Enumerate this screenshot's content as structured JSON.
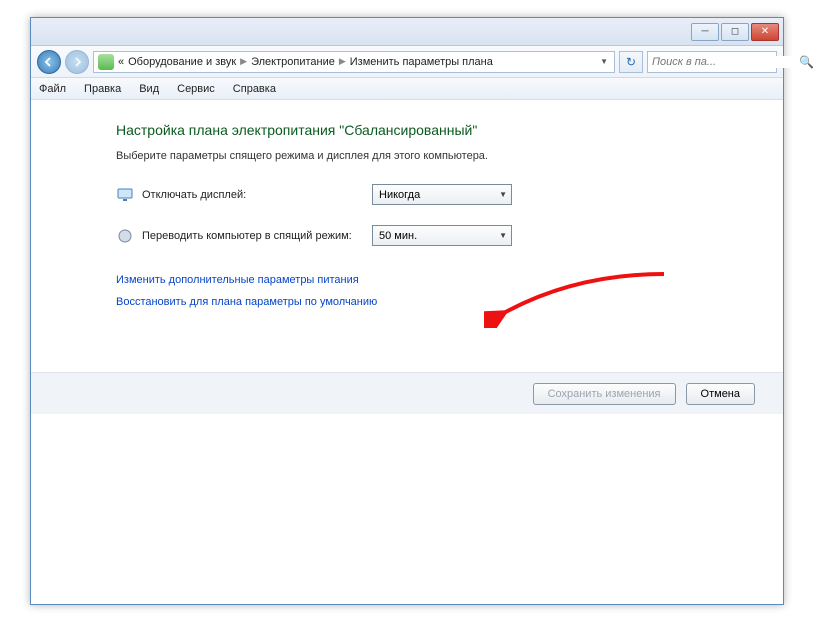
{
  "breadcrumb": {
    "prefix": "«",
    "seg1": "Оборудование и звук",
    "seg2": "Электропитание",
    "seg3": "Изменить параметры плана"
  },
  "search": {
    "placeholder": "Поиск в па..."
  },
  "menu": {
    "file": "Файл",
    "edit": "Правка",
    "view": "Вид",
    "tools": "Сервис",
    "help": "Справка"
  },
  "page": {
    "heading": "Настройка плана электропитания \"Сбалансированный\"",
    "subtext": "Выберите параметры спящего режима и дисплея для этого компьютера."
  },
  "rows": {
    "display": {
      "label": "Отключать дисплей:",
      "value": "Никогда"
    },
    "sleep": {
      "label": "Переводить компьютер в спящий режим:",
      "value": "50 мин."
    }
  },
  "links": {
    "advanced": "Изменить дополнительные параметры питания",
    "restore": "Восстановить для плана параметры по умолчанию"
  },
  "buttons": {
    "save": "Сохранить изменения",
    "cancel": "Отмена"
  }
}
